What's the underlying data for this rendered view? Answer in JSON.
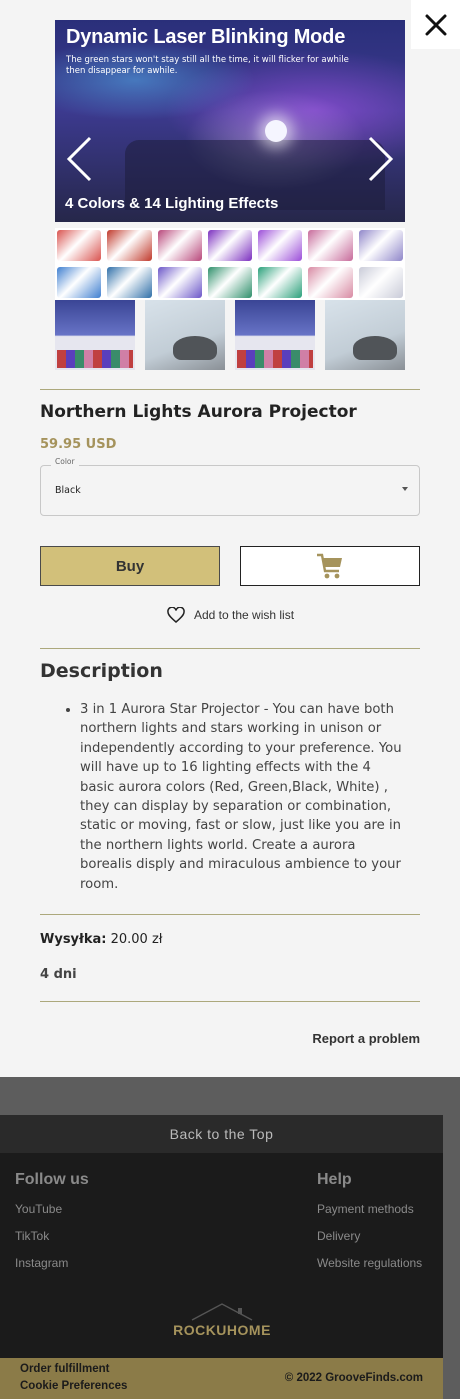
{
  "product": {
    "hero": {
      "headline": "Dynamic Laser Blinking Mode",
      "subline": "The green stars won't stay still all the time, it will flicker for awhile  then disappear for awhile.",
      "caption": "4 Colors & 14 Lighting Effects",
      "swatch_colors": [
        "#d9534f",
        "#c0392b",
        "#b8477a",
        "#7b2fbf",
        "#9b4dd8",
        "#c76a9a",
        "#8f86c9",
        "#3f7fd0",
        "#2f6fa8",
        "#6b56c8",
        "#2e8f6a",
        "#2aa07a",
        "#d88aa3",
        "#c9cbd8"
      ]
    },
    "title": "Northern Lights Aurora Projector",
    "price": "59.95 USD",
    "color_select": {
      "label": "Color",
      "value": "Black"
    },
    "buy_label": "Buy",
    "wishlist_label": "Add to the wish list",
    "description_heading": "Description",
    "description": "3 in 1 Aurora Star Projector - You can have both northern lights and stars working in unison or independently according to your preference. You will have up to 16 lighting effects with the 4 basic aurora colors (Red, Green,Black, White) , they can display by separation or combination, static or moving, fast or slow, just like you are in the northern lights world. Create a aurora borealis disply and miraculous ambience to your room.",
    "shipping_label": "Wysyłka:",
    "shipping_value": "20.00 zł",
    "delivery_time": "4 dni",
    "report_label": "Report a problem"
  },
  "footer": {
    "back_to_top": "Back to the Top",
    "follow_heading": "Follow us",
    "follow_links": [
      "YouTube",
      "TikTok",
      "Instagram"
    ],
    "help_heading": "Help",
    "help_links": [
      "Payment methods",
      "Delivery",
      "Website regulations"
    ],
    "logo_text": "ROCKUHOME",
    "bottom_links": [
      "Order fulfillment",
      "Cookie Preferences"
    ],
    "copyright": "© 2022 GrooveFinds.com"
  },
  "colors": {
    "accent": "#d2c07a",
    "price": "#a5935c",
    "divider": "#aca87c",
    "footer_bar": "#8b7b48"
  },
  "icons": [
    "close-icon",
    "chevron-left-icon",
    "chevron-right-icon",
    "cart-icon",
    "heart-icon",
    "house-roof-icon"
  ]
}
